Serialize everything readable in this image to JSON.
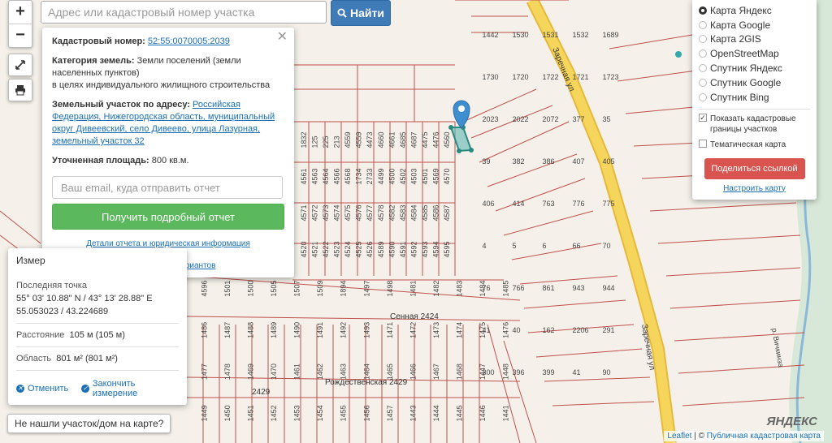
{
  "search": {
    "placeholder": "Адрес или кадастровый номер участка",
    "button_label": "Найти"
  },
  "zoom": {
    "in_label": "+",
    "out_label": "−"
  },
  "popup": {
    "cadastral_label": "Кадастровый номер:",
    "cadastral_value": "52:55:0070005:2039",
    "category_label": "Категория земель:",
    "category_value": "Земли поселений (земли населенных пунктов)",
    "category_note": "в целях индивидуального жилищного строительства",
    "address_label": "Земельный участок по адресу:",
    "address_value": "Российская Федерация, Нижегородская область, муниципальный округ Дивеевский, село Дивеево, улица Лазурная, земельный участок 32",
    "area_label": "Уточненная площадь:",
    "area_value": "800 кв.м.",
    "email_placeholder": "Ваш email, куда отправить отчет",
    "report_button": "Получить подробный отчет",
    "details_link": "Детали отчета и юридическая информация",
    "manual_link": "Ручной выбор вариантов"
  },
  "measure": {
    "title": "Измер",
    "last_point_label": "Последняя точка",
    "coords_dms": "55° 03' 10.88\" N / 43° 13' 28.88\" E",
    "coords_dec": "55.053023 / 43.224689",
    "distance_label": "Расстояние",
    "distance_value": "105 м (105 м)",
    "area_label": "Область",
    "area_value": "801 м² (801 м²)",
    "cancel": "Отменить",
    "finish": "Закончить измерение"
  },
  "not_found": "Не нашли участок/дом на карте?",
  "layers": {
    "options": [
      {
        "label": "Карта Яндекс",
        "selected": true
      },
      {
        "label": "Карта Google",
        "selected": false
      },
      {
        "label": "Карта 2GIS",
        "selected": false
      },
      {
        "label": "OpenStreetMap",
        "selected": false
      },
      {
        "label": "Спутник Яндекс",
        "selected": false
      },
      {
        "label": "Спутник Google",
        "selected": false
      },
      {
        "label": "Спутник Bing",
        "selected": false
      }
    ],
    "show_cadastral": "Показать кадастровые границы участков",
    "show_cadastral_checked": true,
    "thematic": "Тематическая карта",
    "thematic_checked": false,
    "share_button": "Поделиться ссылкой",
    "setup_link": "Настроить карту"
  },
  "map": {
    "street_labels": [
      "Сенная 2424",
      "Рождественская 2429",
      "Заречная ул",
      "Заречная ул",
      "2429",
      "р. Вичкинза"
    ],
    "parcel_labels": [
      "1832",
      "125",
      "225",
      "213",
      "4559",
      "4559",
      "4473",
      "4660",
      "4661",
      "4685",
      "4687",
      "4475",
      "4476",
      "4560",
      "4561",
      "4563",
      "4564",
      "4566",
      "4568",
      "1734",
      "2733",
      "4499",
      "4500",
      "4502",
      "4503",
      "4501",
      "4569",
      "4570",
      "4571",
      "4572",
      "4573",
      "4574",
      "4575",
      "4576",
      "4577",
      "4578",
      "4582",
      "4583",
      "4584",
      "4585",
      "4586",
      "4587",
      "4520",
      "4521",
      "4522",
      "4523",
      "4524",
      "4525",
      "4526",
      "4589",
      "4590",
      "4591",
      "4592",
      "4593",
      "4594",
      "4595",
      "4596",
      "1501",
      "1500",
      "1505",
      "1507",
      "1509",
      "1894",
      "1497",
      "1498",
      "1481",
      "1482",
      "1483",
      "1484",
      "1485",
      "1486",
      "1487",
      "1488",
      "1489",
      "1490",
      "1491",
      "1492",
      "1493",
      "1471",
      "1472",
      "1473",
      "1474",
      "1475",
      "1476",
      "1477",
      "1478",
      "1469",
      "1470",
      "1461",
      "1462",
      "1463",
      "1464",
      "1465",
      "1466",
      "1467",
      "1468",
      "1447",
      "1448",
      "1449",
      "1450",
      "1451",
      "1452",
      "1453",
      "1454",
      "1455",
      "1456",
      "1457",
      "1443",
      "1444",
      "1445",
      "1446",
      "1441",
      "1442",
      "1530",
      "1531",
      "1532",
      "1689",
      "1730",
      "1720",
      "1722",
      "1721",
      "1723",
      "2023",
      "2022",
      "2072",
      "377",
      "35",
      "39",
      "382",
      "386",
      "407",
      "405",
      "406",
      "414",
      "763",
      "776",
      "775",
      "4",
      "5",
      "6",
      "66",
      "70",
      "76",
      "766",
      "861",
      "943",
      "944",
      "41",
      "40",
      "162",
      "2206",
      "291",
      "300",
      "396",
      "399",
      "41",
      "90"
    ],
    "marker_label": "4568"
  },
  "attribution": {
    "leaflet": "Leaflet",
    "separator": " | © ",
    "source": "Публичная кадастровая карта",
    "yandex": "© Яндекс",
    "logo": "ЯНДЕКС"
  },
  "colors": {
    "parcel_border": "#c0504d",
    "road": "#f6d55c",
    "accent": "#3f7bb7",
    "report_green": "#5cb85c",
    "share_red": "#d9534f",
    "highlight_parcel": "#5fb8b0"
  }
}
